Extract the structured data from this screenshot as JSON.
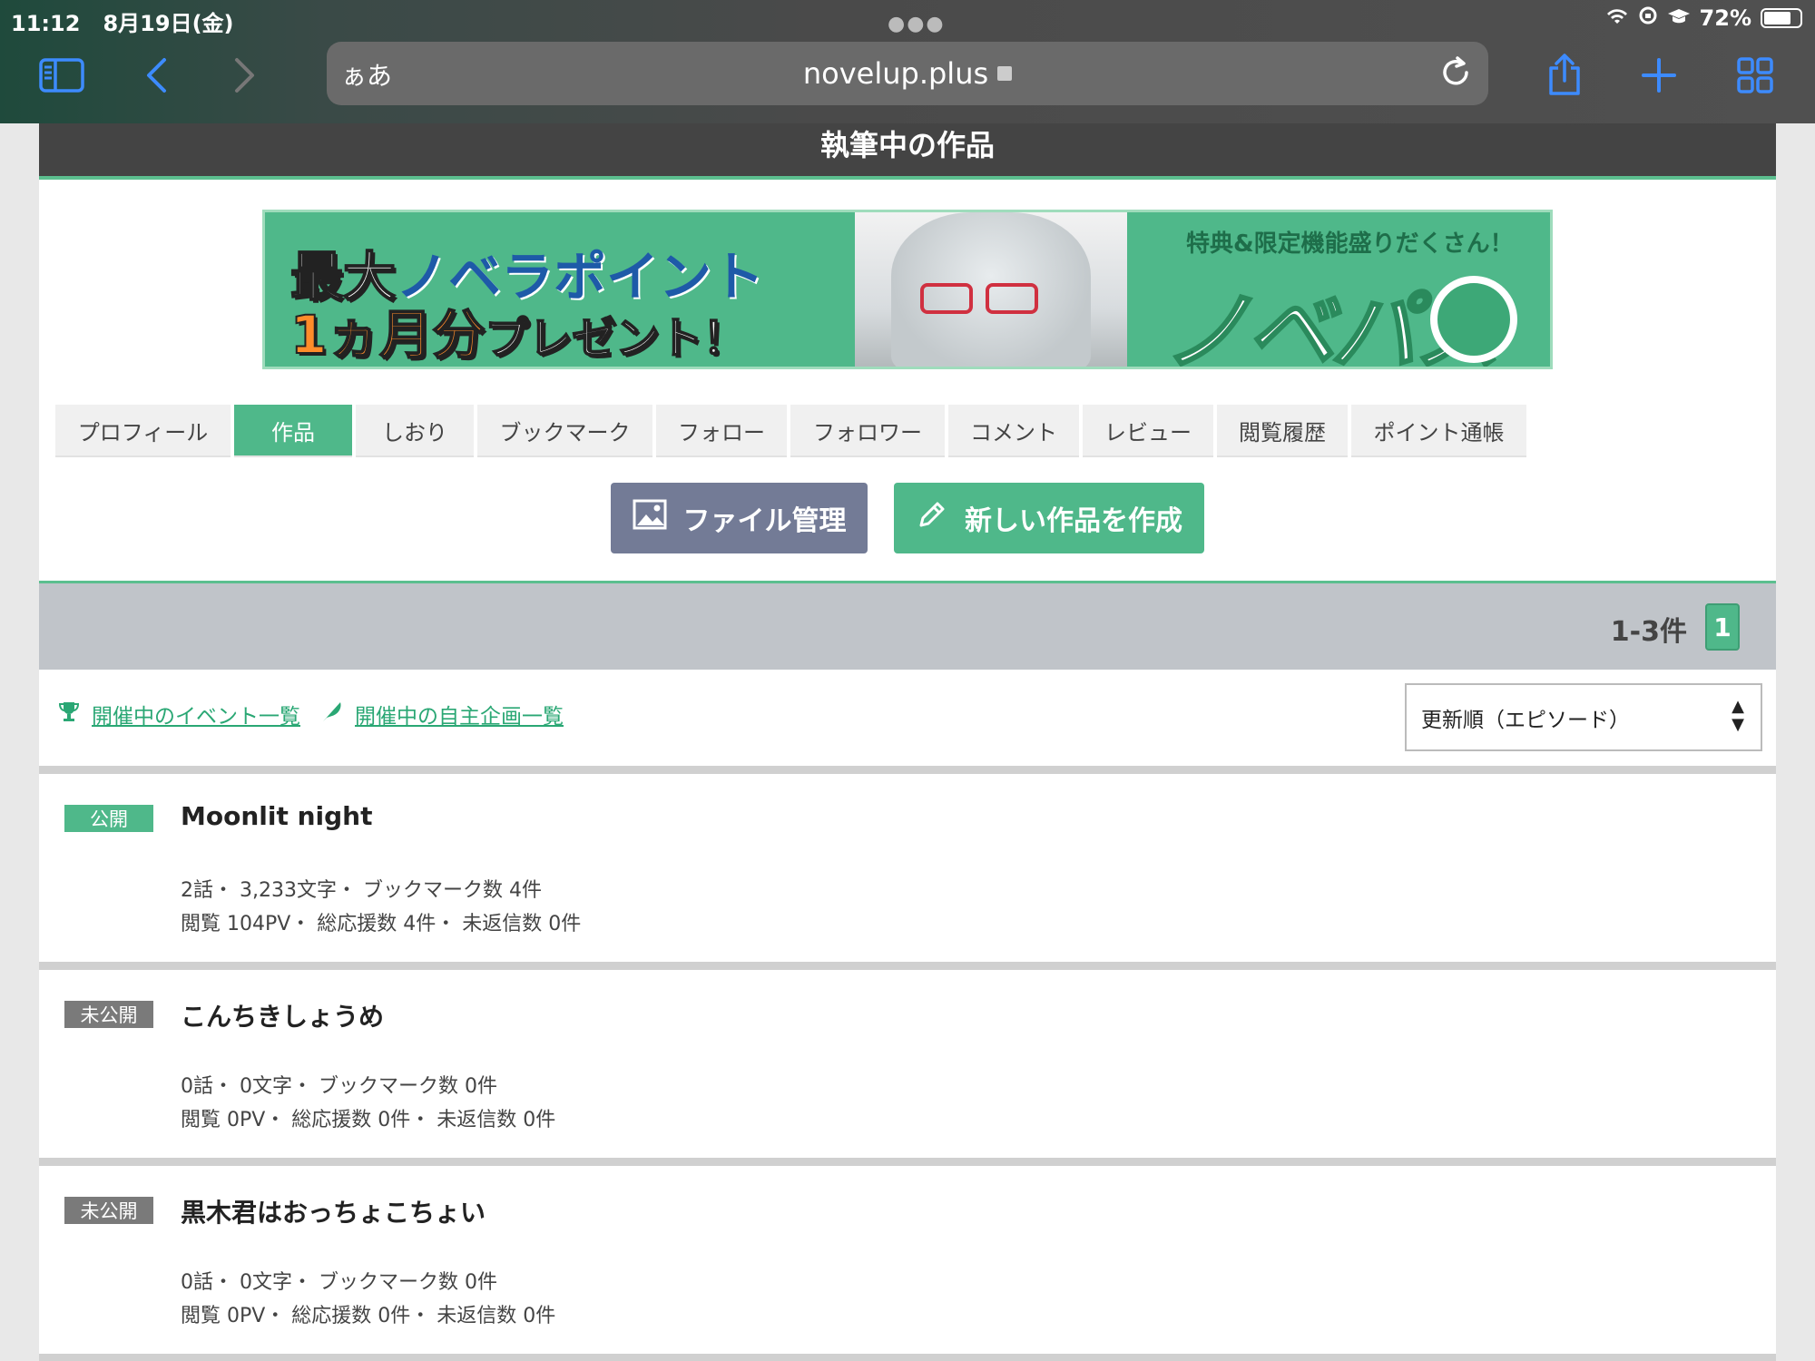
{
  "status": {
    "time": "11:12",
    "date": "8月19日(金)",
    "battery": "72%"
  },
  "browser": {
    "aa": "ぁあ",
    "url": "novelup.plus"
  },
  "page": {
    "heading": "執筆中の作品"
  },
  "banner": {
    "line1a": "最大",
    "line1b": "ノベラポイント",
    "line2a": "1ヵ月分",
    "line2b": "プレゼント！",
    "tagline": "特典&限定機能盛りだくさん！",
    "logo": "ノベパス"
  },
  "tabs": [
    {
      "label": "プロフィール",
      "active": false
    },
    {
      "label": "作品",
      "active": true
    },
    {
      "label": "しおり",
      "active": false
    },
    {
      "label": "ブックマーク",
      "active": false
    },
    {
      "label": "フォロー",
      "active": false
    },
    {
      "label": "フォロワー",
      "active": false
    },
    {
      "label": "コメント",
      "active": false
    },
    {
      "label": "レビュー",
      "active": false
    },
    {
      "label": "閲覧履歴",
      "active": false
    },
    {
      "label": "ポイント通帳",
      "active": false
    }
  ],
  "buttons": {
    "file": "ファイル管理",
    "new_work": "新しい作品を作成"
  },
  "count": {
    "range": "1-3件",
    "page": "1"
  },
  "links": {
    "events": "開催中のイベント一覧",
    "projects": "開催中の自主企画一覧"
  },
  "sort": {
    "selected": "更新順（エピソード）"
  },
  "works": [
    {
      "status": "公開",
      "public": true,
      "title": "Moonlit night",
      "line1": "2話・ 3,233文字・ ブックマーク数 4件",
      "line2": "閲覧 104PV・ 総応援数 4件・ 未返信数 0件"
    },
    {
      "status": "未公開",
      "public": false,
      "title": "こんちきしょうめ",
      "line1": "0話・ 0文字・ ブックマーク数 0件",
      "line2": "閲覧 0PV・ 総応援数 0件・ 未返信数 0件"
    },
    {
      "status": "未公開",
      "public": false,
      "title": "黒木君はおっちょこちょい",
      "line1": "0話・ 0文字・ ブックマーク数 0件",
      "line2": "閲覧 0PV・ 総応援数 0件・ 未返信数 0件"
    }
  ],
  "colors": {
    "accent": "#4fb88a",
    "file_button": "#737b96",
    "header": "#444444",
    "count_bar": "#c0c4c9"
  }
}
